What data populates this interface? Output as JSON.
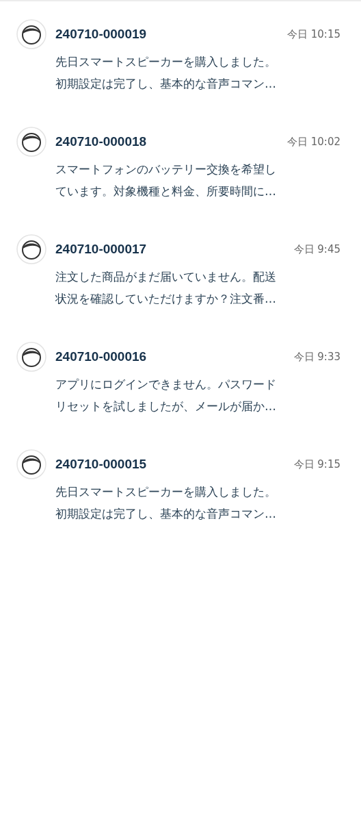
{
  "messages": [
    {
      "ticket": "240710-000019",
      "time": "今日 10:15",
      "lines": [
        "先日スマートスピーカーを購入しました。",
        "初期設定は完了し、基本的な音声コマン…"
      ]
    },
    {
      "ticket": "240710-000018",
      "time": "今日 10:02",
      "lines": [
        "スマートフォンのバッテリー交換を希望し",
        "ています。対象機種と料金、所要時間に…"
      ]
    },
    {
      "ticket": "240710-000017",
      "time": "今日 9:45",
      "lines": [
        "注文した商品がまだ届いていません。配送",
        "状況を確認していただけますか？注文番…"
      ]
    },
    {
      "ticket": "240710-000016",
      "time": "今日 9:33",
      "lines": [
        "アプリにログインできません。パスワード",
        "リセットを試しましたが、メールが届か…"
      ]
    },
    {
      "ticket": "240710-000015",
      "time": "今日 9:15",
      "lines": [
        "先日スマートスピーカーを購入しました。",
        "初期設定は完了し、基本的な音声コマン…"
      ]
    }
  ]
}
